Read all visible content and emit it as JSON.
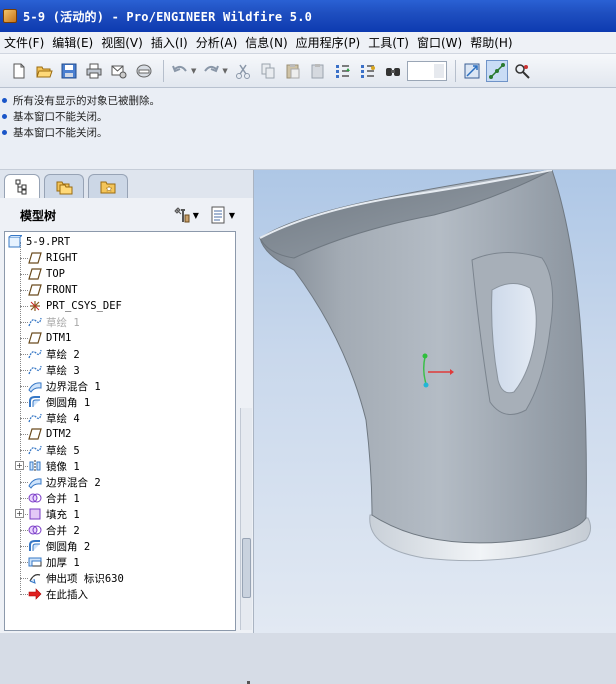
{
  "window": {
    "title": "5-9 (活动的) - Pro/ENGINEER Wildfire 5.0"
  },
  "menubar": {
    "items": [
      {
        "label": "文件(F)"
      },
      {
        "label": "编辑(E)"
      },
      {
        "label": "视图(V)"
      },
      {
        "label": "插入(I)"
      },
      {
        "label": "分析(A)"
      },
      {
        "label": "信息(N)"
      },
      {
        "label": "应用程序(P)"
      },
      {
        "label": "工具(T)"
      },
      {
        "label": "窗口(W)"
      },
      {
        "label": "帮助(H)"
      }
    ]
  },
  "toolbar": {
    "buttons": [
      "new-icon",
      "open-icon",
      "save-icon",
      "print-icon",
      "send-mail-icon",
      "close-window-icon",
      "undo-icon",
      "redo-icon",
      "cut-icon",
      "copy-icon",
      "paste-icon",
      "paste-special-icon",
      "regenerate-icon",
      "regenerate-manager-icon",
      "find-icon",
      "select-box-icon",
      "refit-icon",
      "datum-points-icon",
      "spin-center-icon"
    ]
  },
  "messages": [
    {
      "text": "所有没有显示的对象已被删除。"
    },
    {
      "text": "基本窗口不能关闭。"
    },
    {
      "text": "基本窗口不能关闭。"
    }
  ],
  "navigator": {
    "tabs": [
      "model-tree-tab",
      "folder-browser-tab",
      "favorites-tab"
    ],
    "header": "模型树"
  },
  "tree": {
    "root": "5-9.PRT",
    "items": [
      {
        "label": "RIGHT",
        "icon": "datum-plane-icon",
        "dim": false
      },
      {
        "label": "TOP",
        "icon": "datum-plane-icon",
        "dim": false
      },
      {
        "label": "FRONT",
        "icon": "datum-plane-icon",
        "dim": false
      },
      {
        "label": "PRT_CSYS_DEF",
        "icon": "coordinate-system-icon",
        "dim": false
      },
      {
        "label": "草绘 1",
        "icon": "sketch-icon",
        "dim": true
      },
      {
        "label": "DTM1",
        "icon": "datum-plane-icon",
        "dim": false
      },
      {
        "label": "草绘 2",
        "icon": "sketch-icon",
        "dim": false
      },
      {
        "label": "草绘 3",
        "icon": "sketch-icon",
        "dim": false
      },
      {
        "label": "边界混合 1",
        "icon": "boundary-blend-icon",
        "dim": false
      },
      {
        "label": "倒圆角 1",
        "icon": "round-icon",
        "dim": false
      },
      {
        "label": "草绘 4",
        "icon": "sketch-icon",
        "dim": false
      },
      {
        "label": "DTM2",
        "icon": "datum-plane-icon",
        "dim": false
      },
      {
        "label": "草绘 5",
        "icon": "sketch-icon",
        "dim": false
      },
      {
        "label": "镜像 1",
        "icon": "mirror-icon",
        "dim": false,
        "expandable": true
      },
      {
        "label": "边界混合 2",
        "icon": "boundary-blend-icon",
        "dim": false
      },
      {
        "label": "合并 1",
        "icon": "merge-icon",
        "dim": false
      },
      {
        "label": "填充 1",
        "icon": "fill-icon",
        "dim": false,
        "expandable": true
      },
      {
        "label": "合并 2",
        "icon": "merge-icon",
        "dim": false
      },
      {
        "label": "倒圆角 2",
        "icon": "round-icon",
        "dim": false
      },
      {
        "label": "加厚 1",
        "icon": "thicken-icon",
        "dim": false
      },
      {
        "label": "伸出项 标识630",
        "icon": "protrusion-icon",
        "dim": false
      },
      {
        "label": "在此插入",
        "icon": "insert-here-arrow-icon",
        "dim": false
      }
    ]
  },
  "colors": {
    "titlebar": "#1f4fc0",
    "viewport_top": "#aec7e6",
    "viewport_bottom": "#e2e9f3",
    "model_surface": "#9aa3ad"
  }
}
